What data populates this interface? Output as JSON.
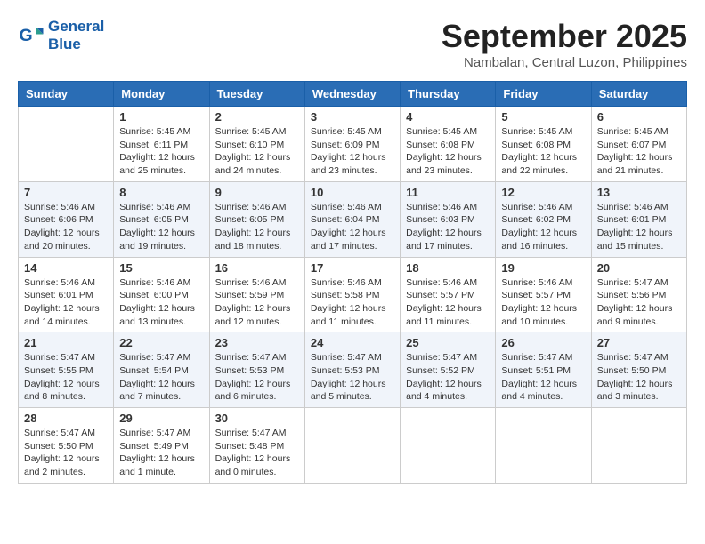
{
  "header": {
    "logo_line1": "General",
    "logo_line2": "Blue",
    "month": "September 2025",
    "location": "Nambalan, Central Luzon, Philippines"
  },
  "weekdays": [
    "Sunday",
    "Monday",
    "Tuesday",
    "Wednesday",
    "Thursday",
    "Friday",
    "Saturday"
  ],
  "weeks": [
    [
      {
        "day": "",
        "info": ""
      },
      {
        "day": "1",
        "info": "Sunrise: 5:45 AM\nSunset: 6:11 PM\nDaylight: 12 hours\nand 25 minutes."
      },
      {
        "day": "2",
        "info": "Sunrise: 5:45 AM\nSunset: 6:10 PM\nDaylight: 12 hours\nand 24 minutes."
      },
      {
        "day": "3",
        "info": "Sunrise: 5:45 AM\nSunset: 6:09 PM\nDaylight: 12 hours\nand 23 minutes."
      },
      {
        "day": "4",
        "info": "Sunrise: 5:45 AM\nSunset: 6:08 PM\nDaylight: 12 hours\nand 23 minutes."
      },
      {
        "day": "5",
        "info": "Sunrise: 5:45 AM\nSunset: 6:08 PM\nDaylight: 12 hours\nand 22 minutes."
      },
      {
        "day": "6",
        "info": "Sunrise: 5:45 AM\nSunset: 6:07 PM\nDaylight: 12 hours\nand 21 minutes."
      }
    ],
    [
      {
        "day": "7",
        "info": "Sunrise: 5:46 AM\nSunset: 6:06 PM\nDaylight: 12 hours\nand 20 minutes."
      },
      {
        "day": "8",
        "info": "Sunrise: 5:46 AM\nSunset: 6:05 PM\nDaylight: 12 hours\nand 19 minutes."
      },
      {
        "day": "9",
        "info": "Sunrise: 5:46 AM\nSunset: 6:05 PM\nDaylight: 12 hours\nand 18 minutes."
      },
      {
        "day": "10",
        "info": "Sunrise: 5:46 AM\nSunset: 6:04 PM\nDaylight: 12 hours\nand 17 minutes."
      },
      {
        "day": "11",
        "info": "Sunrise: 5:46 AM\nSunset: 6:03 PM\nDaylight: 12 hours\nand 17 minutes."
      },
      {
        "day": "12",
        "info": "Sunrise: 5:46 AM\nSunset: 6:02 PM\nDaylight: 12 hours\nand 16 minutes."
      },
      {
        "day": "13",
        "info": "Sunrise: 5:46 AM\nSunset: 6:01 PM\nDaylight: 12 hours\nand 15 minutes."
      }
    ],
    [
      {
        "day": "14",
        "info": "Sunrise: 5:46 AM\nSunset: 6:01 PM\nDaylight: 12 hours\nand 14 minutes."
      },
      {
        "day": "15",
        "info": "Sunrise: 5:46 AM\nSunset: 6:00 PM\nDaylight: 12 hours\nand 13 minutes."
      },
      {
        "day": "16",
        "info": "Sunrise: 5:46 AM\nSunset: 5:59 PM\nDaylight: 12 hours\nand 12 minutes."
      },
      {
        "day": "17",
        "info": "Sunrise: 5:46 AM\nSunset: 5:58 PM\nDaylight: 12 hours\nand 11 minutes."
      },
      {
        "day": "18",
        "info": "Sunrise: 5:46 AM\nSunset: 5:57 PM\nDaylight: 12 hours\nand 11 minutes."
      },
      {
        "day": "19",
        "info": "Sunrise: 5:46 AM\nSunset: 5:57 PM\nDaylight: 12 hours\nand 10 minutes."
      },
      {
        "day": "20",
        "info": "Sunrise: 5:47 AM\nSunset: 5:56 PM\nDaylight: 12 hours\nand 9 minutes."
      }
    ],
    [
      {
        "day": "21",
        "info": "Sunrise: 5:47 AM\nSunset: 5:55 PM\nDaylight: 12 hours\nand 8 minutes."
      },
      {
        "day": "22",
        "info": "Sunrise: 5:47 AM\nSunset: 5:54 PM\nDaylight: 12 hours\nand 7 minutes."
      },
      {
        "day": "23",
        "info": "Sunrise: 5:47 AM\nSunset: 5:53 PM\nDaylight: 12 hours\nand 6 minutes."
      },
      {
        "day": "24",
        "info": "Sunrise: 5:47 AM\nSunset: 5:53 PM\nDaylight: 12 hours\nand 5 minutes."
      },
      {
        "day": "25",
        "info": "Sunrise: 5:47 AM\nSunset: 5:52 PM\nDaylight: 12 hours\nand 4 minutes."
      },
      {
        "day": "26",
        "info": "Sunrise: 5:47 AM\nSunset: 5:51 PM\nDaylight: 12 hours\nand 4 minutes."
      },
      {
        "day": "27",
        "info": "Sunrise: 5:47 AM\nSunset: 5:50 PM\nDaylight: 12 hours\nand 3 minutes."
      }
    ],
    [
      {
        "day": "28",
        "info": "Sunrise: 5:47 AM\nSunset: 5:50 PM\nDaylight: 12 hours\nand 2 minutes."
      },
      {
        "day": "29",
        "info": "Sunrise: 5:47 AM\nSunset: 5:49 PM\nDaylight: 12 hours\nand 1 minute."
      },
      {
        "day": "30",
        "info": "Sunrise: 5:47 AM\nSunset: 5:48 PM\nDaylight: 12 hours\nand 0 minutes."
      },
      {
        "day": "",
        "info": ""
      },
      {
        "day": "",
        "info": ""
      },
      {
        "day": "",
        "info": ""
      },
      {
        "day": "",
        "info": ""
      }
    ]
  ]
}
